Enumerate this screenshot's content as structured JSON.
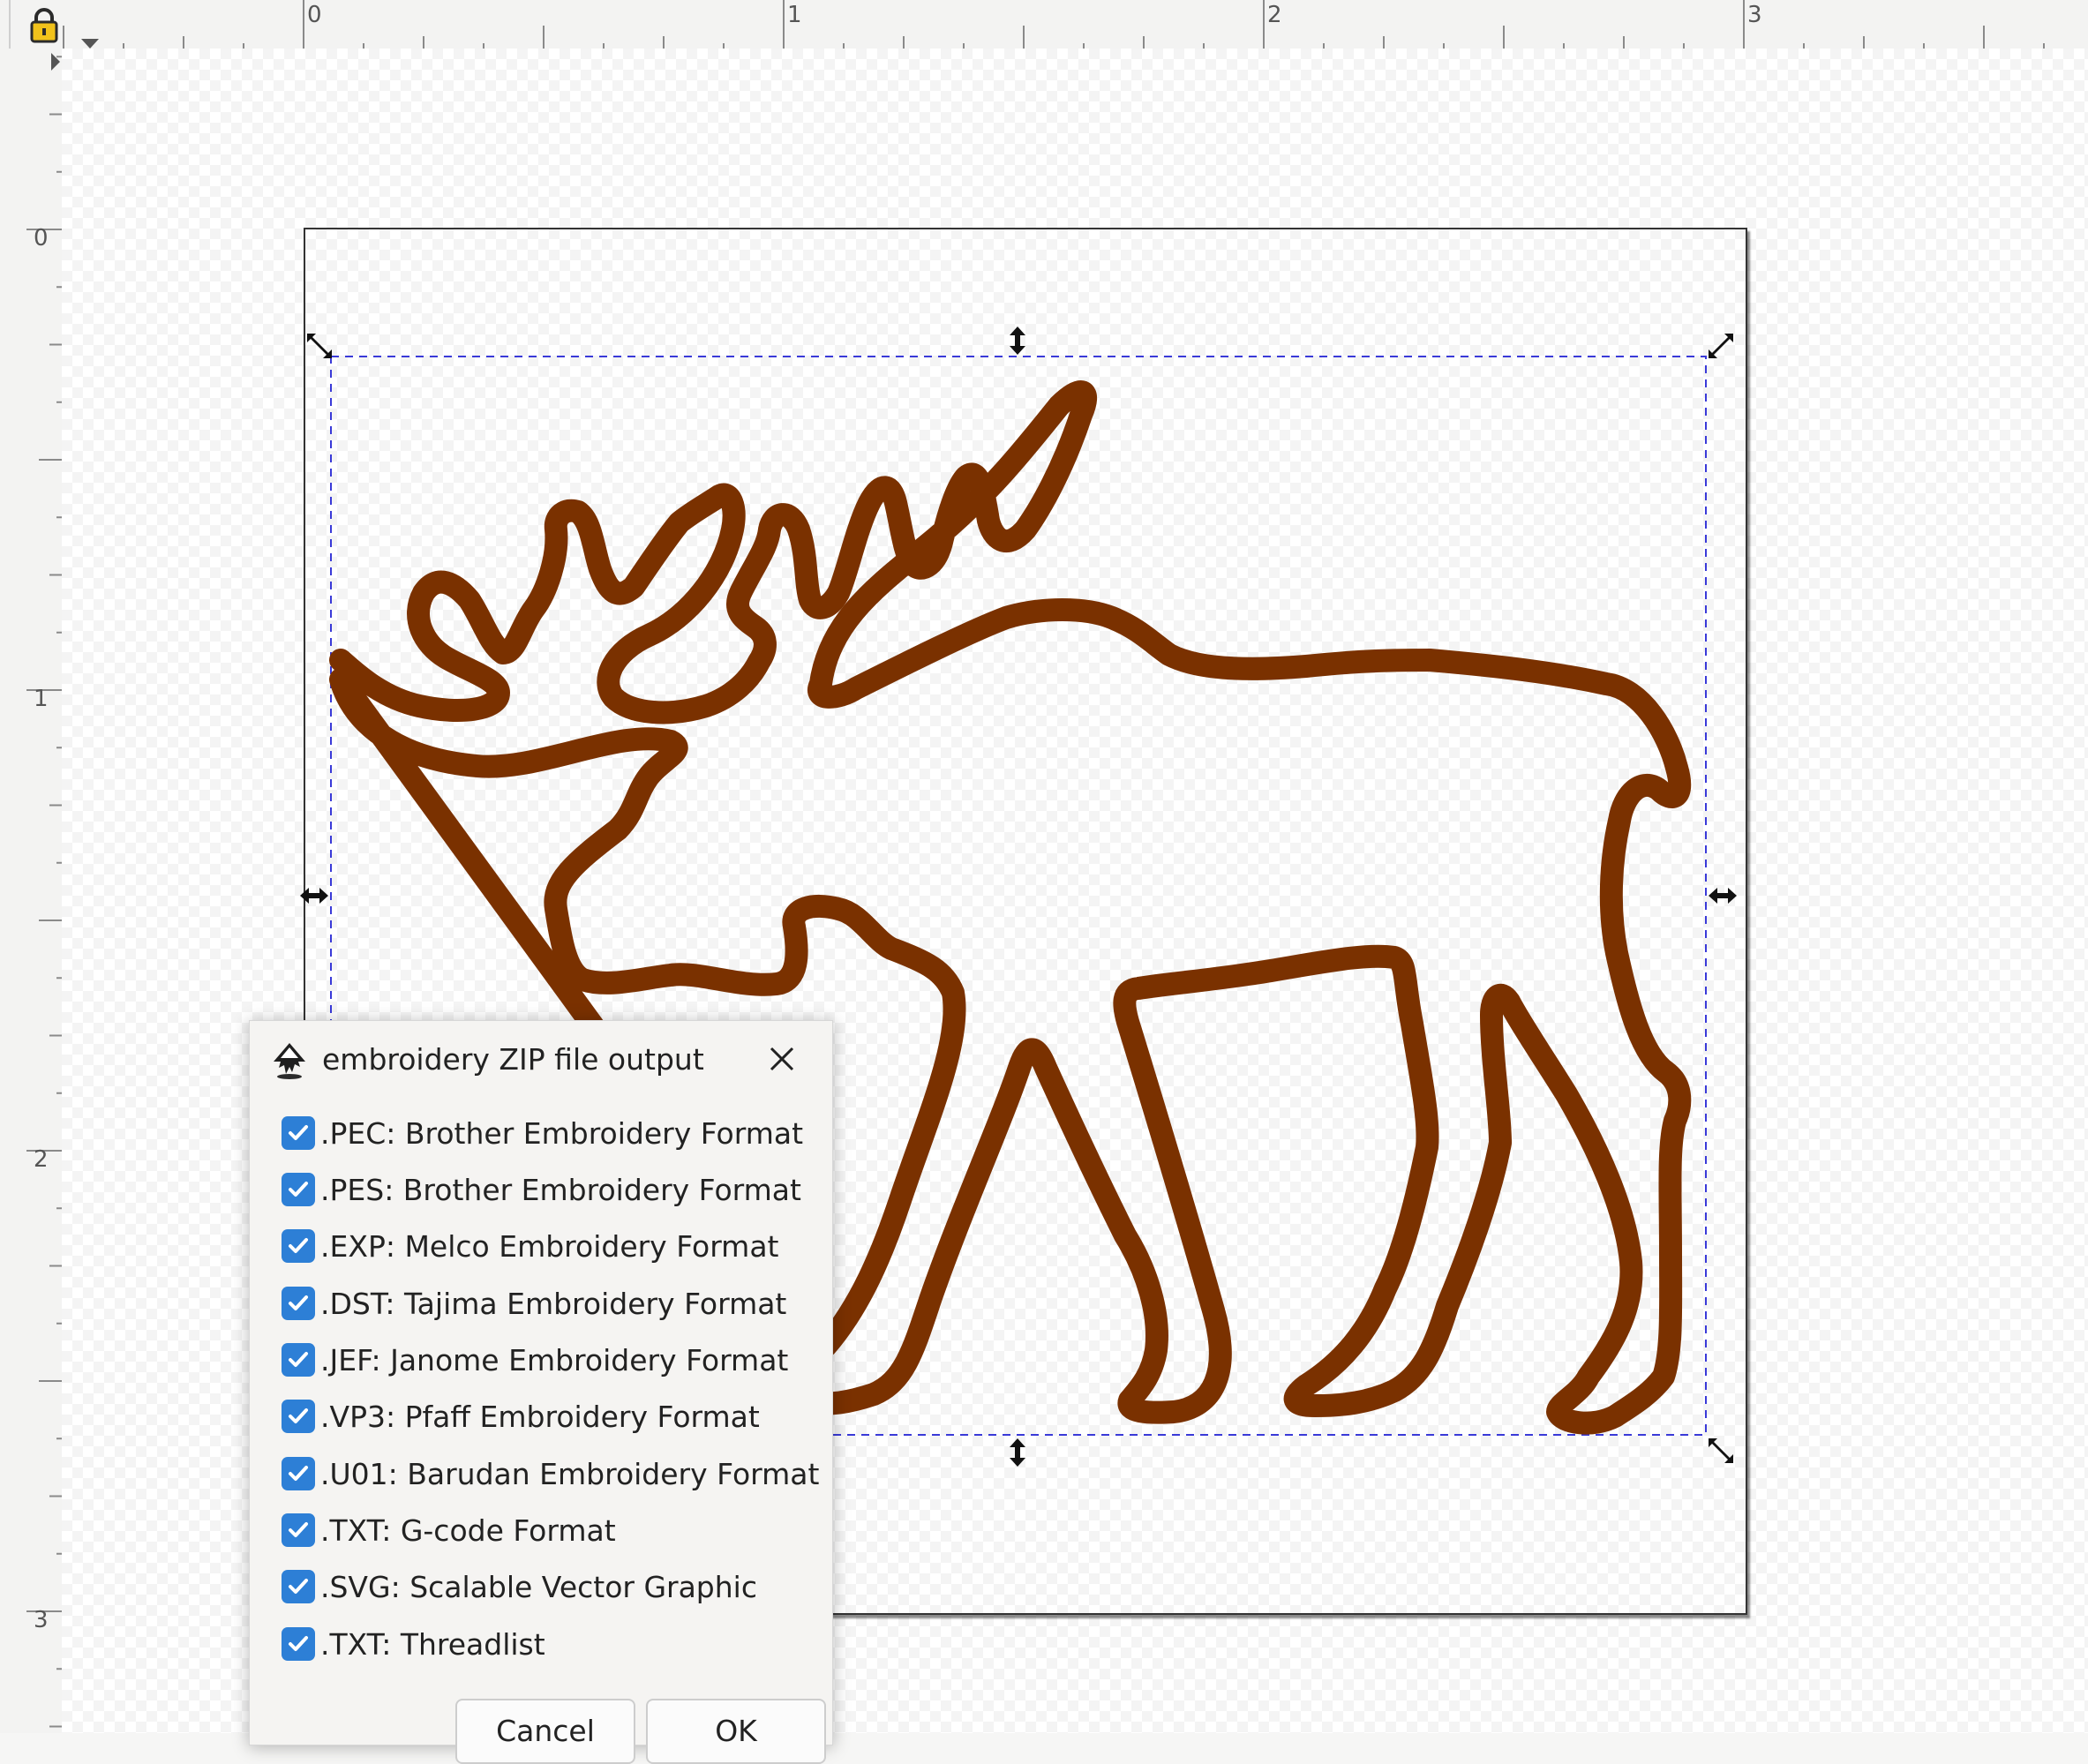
{
  "ruler": {
    "top_labels": [
      "0",
      "1",
      "2",
      "3"
    ],
    "left_labels": [
      "0",
      "1",
      "2",
      "3"
    ]
  },
  "canvas": {
    "artwork": "moose-outline",
    "stroke_color": "#7a3100",
    "selection_color": "#3a3ad8"
  },
  "dialog": {
    "title": "embroidery ZIP file output",
    "options": [
      {
        "label": ".PEC: Brother Embroidery Format",
        "checked": true
      },
      {
        "label": ".PES: Brother Embroidery Format",
        "checked": true
      },
      {
        "label": ".EXP: Melco Embroidery Format",
        "checked": true
      },
      {
        "label": ".DST: Tajima Embroidery Format",
        "checked": true
      },
      {
        "label": ".JEF: Janome Embroidery Format",
        "checked": true
      },
      {
        "label": ".VP3: Pfaff Embroidery Format",
        "checked": true
      },
      {
        "label": ".U01: Barudan Embroidery Format",
        "checked": true
      },
      {
        "label": ".TXT: G-code Format",
        "checked": true
      },
      {
        "label": ".SVG: Scalable Vector Graphic",
        "checked": true
      },
      {
        "label": ".TXT: Threadlist",
        "checked": true
      }
    ],
    "cancel_label": "Cancel",
    "ok_label": "OK",
    "check_color": "#2d7fd6"
  }
}
